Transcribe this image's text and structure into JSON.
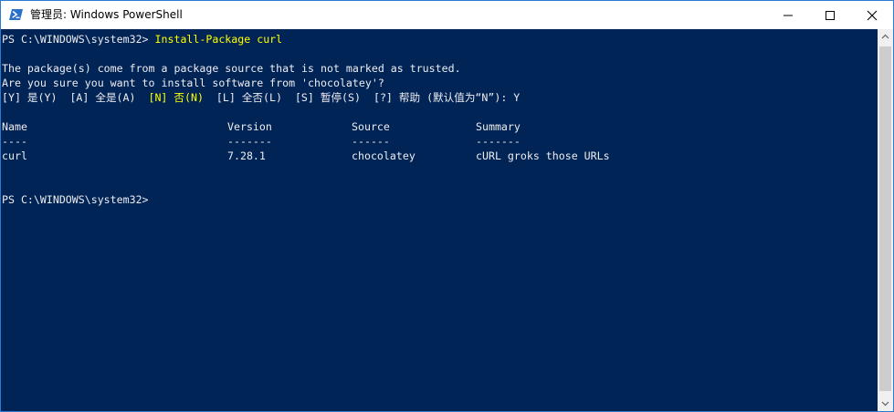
{
  "window": {
    "title": "管理员: Windows PowerShell"
  },
  "icons": {
    "app": "powershell-icon",
    "minimize": "minimize-icon",
    "maximize": "maximize-icon",
    "close": "close-icon"
  },
  "colors": {
    "console_background": "#012456",
    "console_text": "#eeedf0",
    "command_highlight": "#ffff00",
    "title_bar": "#ffffff"
  },
  "console": {
    "prompt1": "PS C:\\WINDOWS\\system32> ",
    "command": "Install-Package curl",
    "warning_line1": "The package(s) come from a package source that is not marked as trusted.",
    "warning_line2": "Are you sure you want to install software from 'chocolatey'?",
    "choices": {
      "yes": "[Y] 是(Y)",
      "yes_all": "[A] 全是(A)",
      "no": "[N] 否(N)",
      "no_all": "[L] 全否(L)",
      "suspend": "[S] 暂停(S)",
      "help": "[?] 帮助",
      "default_prompt": "(默认值为“N”): Y"
    },
    "table": {
      "headers": [
        "Name",
        "Version",
        "Source",
        "Summary"
      ],
      "underlines": [
        "----",
        "-------",
        "------",
        "-------"
      ],
      "rows": [
        [
          "curl",
          "7.28.1",
          "chocolatey",
          "cURL groks those URLs"
        ]
      ]
    },
    "prompt2": "PS C:\\WINDOWS\\system32>"
  }
}
